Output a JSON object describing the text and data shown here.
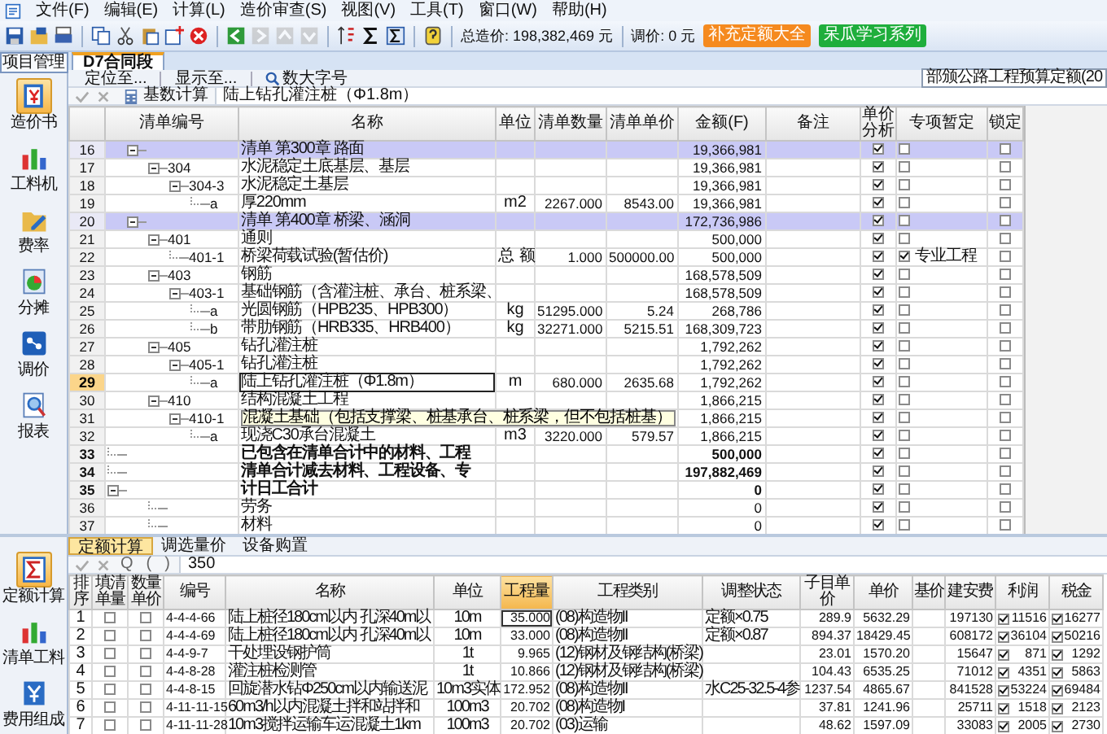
{
  "menu": [
    "文件(F)",
    "编辑(E)",
    "计算(L)",
    "造价审查(S)",
    "视图(V)",
    "工具(T)",
    "窗口(W)",
    "帮助(H)"
  ],
  "toolbar": {
    "total_price": "总造价: 198,382,469 元",
    "adjust_price": "调价: 0 元",
    "buttons": [
      {
        "label": "补充定额大全",
        "color": "#f58a1f"
      },
      {
        "label": "呆瓜学习系列",
        "color": "#1fae3c"
      }
    ]
  },
  "sidebar_top": {
    "tab": "项目管理",
    "items": [
      {
        "label": "造价书",
        "selected": true
      },
      {
        "label": "工料机",
        "selected": false
      },
      {
        "label": "费率",
        "selected": false
      },
      {
        "label": "分摊",
        "selected": false
      },
      {
        "label": "调价",
        "selected": false
      },
      {
        "label": "报表",
        "selected": false
      }
    ]
  },
  "document_tabs": [
    {
      "label": "D7合同段",
      "selected": true
    }
  ],
  "locate_bar": {
    "buttons": [
      "定位至...",
      "显示至...",
      "数大字号"
    ],
    "quota_library": "部颁公路工程预算定额(20"
  },
  "edit_bar": {
    "button": "基数计算",
    "value": "陆上钻孔灌注桩（Φ1.8m）"
  },
  "bill_table": {
    "columns": [
      "清单编号",
      "名称",
      "单位",
      "清单数量",
      "清单单价",
      "金额(F)",
      "备注",
      "单价分析",
      "专项暂定",
      "锁定"
    ],
    "rows": [
      {
        "number": "16",
        "kind": "chapter",
        "name": "清单 第300章 路面",
        "amount": "19,366,981",
        "expanded": true,
        "selected": false,
        "highlighted": false,
        "unit_analysis": true,
        "provisional": false,
        "locked": false,
        "children": [
          {
            "number": "17",
            "kind": "item",
            "code": "304",
            "name": "水泥稳定土底基层、基层",
            "amount": "19,366,981",
            "expanded": true,
            "selected": false,
            "highlighted": false,
            "unit_analysis": true,
            "provisional": false,
            "locked": false,
            "children": [
              {
                "number": "18",
                "kind": "item",
                "code": "304-3",
                "name": "水泥稳定土基层",
                "amount": "19,366,981",
                "expanded": true,
                "selected": false,
                "highlighted": false,
                "unit_analysis": true,
                "provisional": false,
                "locked": false,
                "children": [
                  {
                    "number": "19",
                    "kind": "item",
                    "code": "a",
                    "name": "厚220mm",
                    "unit": "m2",
                    "quantity": "2267.000",
                    "unit_price": "8543.00",
                    "amount": "19,366,981",
                    "selected": false,
                    "highlighted": false,
                    "unit_analysis": true,
                    "provisional": false,
                    "locked": false
                  }
                ]
              }
            ]
          }
        ]
      },
      {
        "number": "20",
        "kind": "chapter",
        "name": "清单 第400章 桥梁、涵洞",
        "amount": "172,736,986",
        "expanded": true,
        "selected": false,
        "highlighted": false,
        "unit_analysis": true,
        "provisional": false,
        "locked": false,
        "children": [
          {
            "number": "21",
            "kind": "item",
            "code": "401",
            "name": "通则",
            "amount": "500,000",
            "expanded": true,
            "selected": false,
            "highlighted": false,
            "unit_analysis": true,
            "provisional": false,
            "locked": false,
            "children": [
              {
                "number": "22",
                "kind": "item",
                "code": "401-1",
                "name": "桥梁荷载试验(暂估价)",
                "unit": "总 额",
                "quantity": "1.000",
                "unit_price": "500000.00",
                "amount": "500,000",
                "selected": false,
                "highlighted": false,
                "unit_analysis": true,
                "provisional": true,
                "provisional_note": "专业工程",
                "locked": false
              }
            ]
          },
          {
            "number": "23",
            "kind": "item",
            "code": "403",
            "name": "钢筋",
            "amount": "168,578,509",
            "expanded": true,
            "selected": false,
            "highlighted": false,
            "unit_analysis": true,
            "provisional": false,
            "locked": false,
            "children": [
              {
                "number": "24",
                "kind": "item",
                "code": "403-1",
                "name": "基础钢筋（含灌注桩、承台、桩系梁、",
                "amount": "168,578,509",
                "expanded": true,
                "selected": false,
                "highlighted": false,
                "unit_analysis": true,
                "provisional": false,
                "locked": false,
                "children": [
                  {
                    "number": "25",
                    "kind": "item",
                    "code": "a",
                    "name": "光圆钢筋（HPB235、HPB300）",
                    "unit": "kg",
                    "quantity": "51295.000",
                    "unit_price": "5.24",
                    "amount": "268,786",
                    "selected": false,
                    "highlighted": false,
                    "unit_analysis": true,
                    "provisional": false,
                    "locked": false
                  },
                  {
                    "number": "26",
                    "kind": "item",
                    "code": "b",
                    "name": "带肋钢筋（HRB335、HRB400）",
                    "unit": "kg",
                    "quantity": "32271.000",
                    "unit_price": "5215.51",
                    "amount": "168,309,723",
                    "selected": false,
                    "highlighted": false,
                    "unit_analysis": true,
                    "provisional": false,
                    "locked": false
                  }
                ]
              }
            ]
          },
          {
            "number": "27",
            "kind": "item",
            "code": "405",
            "name": "钻孔灌注桩",
            "amount": "1,792,262",
            "expanded": true,
            "selected": false,
            "highlighted": false,
            "unit_analysis": true,
            "provisional": false,
            "locked": false,
            "children": [
              {
                "number": "28",
                "kind": "item",
                "code": "405-1",
                "name": "钻孔灌注桩",
                "amount": "1,792,262",
                "expanded": true,
                "selected": false,
                "highlighted": false,
                "unit_analysis": true,
                "provisional": false,
                "locked": false,
                "children": [
                  {
                    "number": "29",
                    "kind": "item",
                    "code": "a",
                    "name": "陆上钻孔灌注桩（Φ1.8m）",
                    "unit": "m",
                    "quantity": "680.000",
                    "unit_price": "2635.68",
                    "amount": "1,792,262",
                    "selected": true,
                    "highlighted": false,
                    "unit_analysis": true,
                    "provisional": false,
                    "locked": false
                  }
                ]
              }
            ]
          },
          {
            "number": "30",
            "kind": "item",
            "code": "410",
            "name": "结构混凝土工程",
            "amount": "1,866,215",
            "expanded": true,
            "selected": false,
            "highlighted": false,
            "unit_analysis": true,
            "provisional": false,
            "locked": false,
            "children": [
              {
                "number": "31",
                "kind": "item",
                "code": "410-1",
                "name": "混凝土基础（包括支撑梁、桩基承台、桩系梁，但不包括桩基）",
                "amount": "1,866,215",
                "expanded": true,
                "selected": false,
                "highlighted": true,
                "unit_analysis": true,
                "provisional": false,
                "locked": false,
                "children": [
                  {
                    "number": "32",
                    "kind": "item",
                    "code": "a",
                    "name": "现浇C30承台混凝土",
                    "unit": "m3",
                    "quantity": "3220.000",
                    "unit_price": "579.57",
                    "amount": "1,866,215",
                    "selected": false,
                    "highlighted": false,
                    "unit_analysis": true,
                    "provisional": false,
                    "locked": false
                  }
                ]
              }
            ]
          }
        ]
      },
      {
        "number": "33",
        "kind": "total",
        "name": "已包含在清单合计中的材料、工程",
        "amount": "500,000",
        "selected": false,
        "highlighted": false,
        "unit_analysis": true,
        "provisional": false,
        "locked": false
      },
      {
        "number": "34",
        "kind": "total",
        "name": "清单合计减去材料、工程设备、专",
        "amount": "197,882,469",
        "selected": false,
        "highlighted": false,
        "unit_analysis": true,
        "provisional": false,
        "locked": false
      },
      {
        "number": "35",
        "kind": "total",
        "name": "计日工合计",
        "amount": "0",
        "expanded": true,
        "selected": false,
        "highlighted": false,
        "unit_analysis": true,
        "provisional": false,
        "locked": false,
        "children": [
          {
            "number": "36",
            "kind": "item",
            "name": "劳务",
            "amount": "0",
            "selected": false,
            "highlighted": false,
            "unit_analysis": true,
            "provisional": false,
            "locked": false
          },
          {
            "number": "37",
            "kind": "item",
            "name": "材料",
            "amount": "0",
            "selected": false,
            "highlighted": false,
            "unit_analysis": true,
            "provisional": false,
            "locked": false
          }
        ]
      }
    ]
  },
  "sidebar_bottom": {
    "items": [
      {
        "label": "定额计算",
        "selected": true
      },
      {
        "label": "清单工料",
        "selected": false
      },
      {
        "label": "费用组成",
        "selected": false
      }
    ]
  },
  "detail_tabs": [
    {
      "label": "定额计算",
      "selected": true
    },
    {
      "label": "调选量价",
      "selected": false
    },
    {
      "label": "设备购置",
      "selected": false
    }
  ],
  "formula_bar": {
    "buttons": [
      "Q",
      "(",
      ")"
    ],
    "value": "350"
  },
  "quota_table": {
    "columns": [
      "排序",
      "填清单量",
      "数量单价",
      "编号",
      "名称",
      "单位",
      "工程量",
      "工程类别",
      "调整状态",
      "子目单价",
      "单价",
      "基价",
      "建安费",
      "利润",
      "税金"
    ],
    "rows": [
      {
        "number": "1",
        "fill_quantity": false,
        "quantity_price": false,
        "code": "4-4-4-66",
        "name": "陆上桩径180cm以内 孔深40m以",
        "unit": "10m",
        "quantity": "35.000",
        "category": "(08)构造物II",
        "adjustment": "定额×0.75",
        "item_price": "289.9",
        "unit_price": "5632.29",
        "cost": "197130",
        "profit_on": true,
        "profit": "11516",
        "tax_on": true,
        "tax": "16277",
        "selected": true
      },
      {
        "number": "2",
        "fill_quantity": false,
        "quantity_price": false,
        "code": "4-4-4-69",
        "name": "陆上桩径180cm以内 孔深40m以",
        "unit": "10m",
        "quantity": "33.000",
        "category": "(08)构造物II",
        "adjustment": "定额×0.87",
        "item_price": "894.37",
        "unit_price": "18429.45",
        "cost": "608172",
        "profit_on": true,
        "profit": "36104",
        "tax_on": true,
        "tax": "50216",
        "selected": false
      },
      {
        "number": "3",
        "fill_quantity": false,
        "quantity_price": false,
        "code": "4-4-9-7",
        "name": "干处埋设钢护筒",
        "unit": "1t",
        "quantity": "9.965",
        "category": "(12)钢材及钢结构(桥梁)",
        "item_price": "23.01",
        "unit_price": "1570.20",
        "cost": "15647",
        "profit_on": true,
        "profit": "871",
        "tax_on": true,
        "tax": "1292",
        "selected": false
      },
      {
        "number": "4",
        "fill_quantity": false,
        "quantity_price": false,
        "code": "4-4-8-28",
        "name": "灌注桩检测管",
        "unit": "1t",
        "quantity": "10.866",
        "category": "(12)钢材及钢结构(桥梁)",
        "item_price": "104.43",
        "unit_price": "6535.25",
        "cost": "71012",
        "profit_on": true,
        "profit": "4351",
        "tax_on": true,
        "tax": "5863",
        "selected": false
      },
      {
        "number": "5",
        "fill_quantity": false,
        "quantity_price": false,
        "code": "4-4-8-15",
        "name": "回旋潜水钻Φ250cm以内输送泥",
        "unit": "10m3实体",
        "quantity": "172.952",
        "category": "(08)构造物II",
        "adjustment": "水C25-32.5-4参",
        "item_price": "1237.54",
        "unit_price": "4865.67",
        "cost": "841528",
        "profit_on": true,
        "profit": "53224",
        "tax_on": true,
        "tax": "69484",
        "selected": false
      },
      {
        "number": "6",
        "fill_quantity": false,
        "quantity_price": false,
        "code": "4-11-11-15",
        "name": "60m3/h以内混凝土拌和站拌和",
        "unit": "100m3",
        "quantity": "20.702",
        "category": "(08)构造物I",
        "item_price": "37.81",
        "unit_price": "1241.96",
        "cost": "25711",
        "profit_on": true,
        "profit": "1518",
        "tax_on": true,
        "tax": "2123",
        "selected": false
      },
      {
        "number": "7",
        "fill_quantity": false,
        "quantity_price": false,
        "code": "4-11-11-28",
        "name": "10m3搅拌运输车运混凝土1km",
        "unit": "100m3",
        "quantity": "20.702",
        "category": "(03)运输",
        "item_price": "48.62",
        "unit_price": "1597.09",
        "cost": "33083",
        "profit_on": true,
        "profit": "2005",
        "tax_on": true,
        "tax": "2730",
        "selected": false
      }
    ]
  }
}
